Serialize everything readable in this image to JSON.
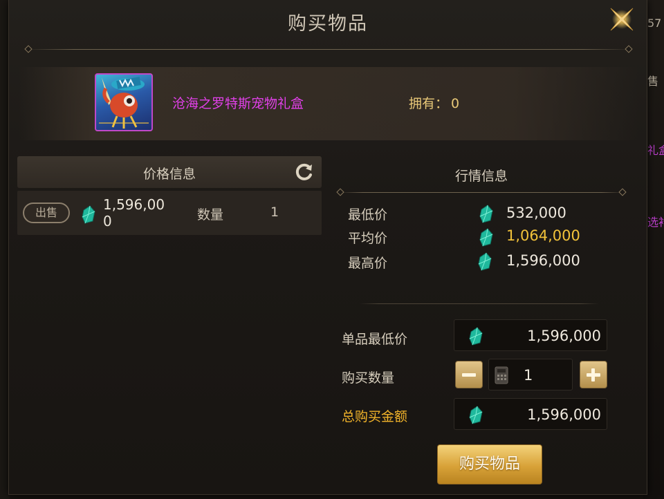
{
  "dialog": {
    "title": "购买物品",
    "buy_button_label": "购买物品"
  },
  "item": {
    "name": "沧海之罗特斯宠物礼盒",
    "owned_label": "拥有：",
    "owned_count": "0"
  },
  "price_info": {
    "header": "价格信息",
    "listing": {
      "badge": "出售",
      "price": "1,596,000",
      "qty_label": "数量",
      "qty": "1"
    }
  },
  "market_info": {
    "header": "行情信息",
    "rows": [
      {
        "label": "最低价",
        "value": "532,000"
      },
      {
        "label": "平均价",
        "value": "1,064,000"
      },
      {
        "label": "最高价",
        "value": "1,596,000"
      }
    ]
  },
  "purchase_form": {
    "unit_min_label": "单品最低价",
    "unit_min_value": "1,596,000",
    "quantity_label": "购买数量",
    "quantity_value": "1",
    "total_label": "总购买金额",
    "total_value": "1,596,000"
  },
  "background_fragments": [
    "57",
    "售",
    "礼盒",
    "选衬"
  ],
  "colors": {
    "item_name": "#e040e8",
    "owned": "#e8c878",
    "average_price": "#f2c23a",
    "total_label": "#f2b42a",
    "buy_button": "#d8a238"
  },
  "icons": [
    "close-icon",
    "refresh-icon",
    "gem-icon",
    "calculator-icon",
    "minus-icon",
    "plus-icon"
  ]
}
